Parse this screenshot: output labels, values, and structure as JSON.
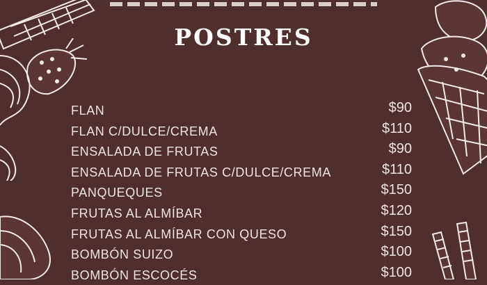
{
  "title": "POSTRES",
  "items": [
    {
      "name": "FLAN",
      "price": "$90"
    },
    {
      "name": "FLAN C/DULCE/CREMA",
      "price": "$110"
    },
    {
      "name": "ENSALADA DE FRUTAS",
      "price": "$90"
    },
    {
      "name": "ENSALADA DE FRUTAS C/DULCE/CREMA",
      "price": "$110"
    },
    {
      "name": "PANQUEQUES",
      "price": "$150"
    },
    {
      "name": "FRUTAS AL ALMÍBAR",
      "price": "$120"
    },
    {
      "name": "FRUTAS AL ALMÍBAR CON QUESO",
      "price": "$150"
    },
    {
      "name": "BOMBÓN SUIZO",
      "price": "$100"
    },
    {
      "name": "BOMBÓN ESCOCÉS",
      "price": "$100"
    }
  ],
  "colors": {
    "background": "#4f2f2d",
    "text": "#eee5e1",
    "illustration": "#f4ecea"
  },
  "illustrations": [
    "wafer-roll-icon",
    "strawberry-icon",
    "ice-cream-cone-icon",
    "whipped-cream-icon"
  ]
}
